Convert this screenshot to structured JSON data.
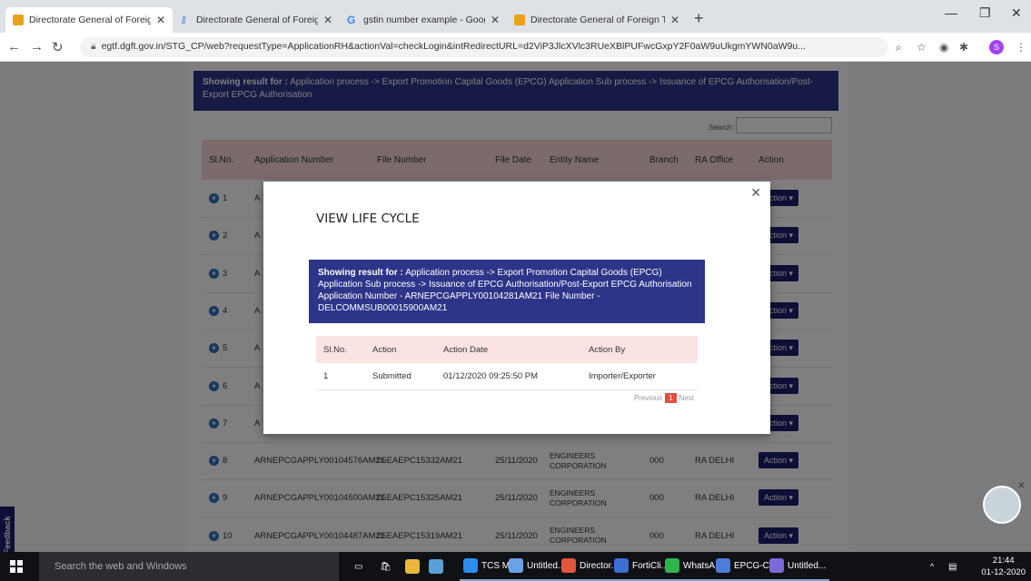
{
  "browser": {
    "tabs": [
      {
        "title": "Directorate General of Foreign T",
        "favicon": "dgft-icon",
        "active": true
      },
      {
        "title": "Directorate General of Foreign T",
        "favicon": "key-icon",
        "active": false
      },
      {
        "title": "gstin number example - Google",
        "favicon": "google-icon",
        "active": false
      },
      {
        "title": "Directorate General of Foreign T",
        "favicon": "dgft-icon",
        "active": false
      }
    ],
    "url": "egtf.dgft.gov.in/STG_CP/web?requestType=ApplicationRH&actionVal=checkLogin&intRedirectURL=d2ViP3JlcXVlc3RUeXBlPUFwcGxpY2F0aW9uUkgmYWN0aW9u...",
    "profile_initial": "S"
  },
  "page": {
    "banner_bold": "Showing result for :",
    "banner_text": " Application process -> Export Promotion Capital Goods (EPCG) Application Sub process -> Issuance of EPCG Authorisation/Post-Export EPCG Authorisation",
    "search_label": "Search:",
    "columns": [
      "Sl.No.",
      "Application Number",
      "File Number",
      "File Date",
      "Entity Name",
      "Branch",
      "RA Office",
      "Action"
    ],
    "action_label": "Action ▾",
    "rows": [
      {
        "sl": "1",
        "app": "A",
        "file": "",
        "date": "",
        "entity": "",
        "branch": "",
        "ra": ""
      },
      {
        "sl": "2",
        "app": "A",
        "file": "",
        "date": "",
        "entity": "",
        "branch": "",
        "ra": ""
      },
      {
        "sl": "3",
        "app": "A",
        "file": "",
        "date": "",
        "entity": "",
        "branch": "",
        "ra": ""
      },
      {
        "sl": "4",
        "app": "A",
        "file": "",
        "date": "",
        "entity": "",
        "branch": "",
        "ra": ""
      },
      {
        "sl": "5",
        "app": "A",
        "file": "",
        "date": "",
        "entity": "",
        "branch": "",
        "ra": ""
      },
      {
        "sl": "6",
        "app": "A",
        "file": "",
        "date": "",
        "entity": "",
        "branch": "",
        "ra": ""
      },
      {
        "sl": "7",
        "app": "A",
        "file": "",
        "date": "",
        "entity": "",
        "branch": "",
        "ra": ""
      },
      {
        "sl": "8",
        "app": "ARNEPCGAPPLY00104576AM21",
        "file": "05EAEPC15332AM21",
        "date": "25/11/2020",
        "entity": "ENGINEERS CORPORATION",
        "branch": "000",
        "ra": "RA DELHI"
      },
      {
        "sl": "9",
        "app": "ARNEPCGAPPLY00104500AM21",
        "file": "05EAEPC15325AM21",
        "date": "25/11/2020",
        "entity": "ENGINEERS CORPORATION",
        "branch": "000",
        "ra": "RA DELHI"
      },
      {
        "sl": "10",
        "app": "ARNEPCGAPPLY00104487AM21",
        "file": "05EAEPC15319AM21",
        "date": "25/11/2020",
        "entity": "ENGINEERS CORPORATION",
        "branch": "000",
        "ra": "RA DELHI"
      }
    ],
    "feedback": "Feedback"
  },
  "modal": {
    "title": "VIEW LIFE CYCLE",
    "banner_bold": "Showing result for :",
    "banner_text": " Application process -> Export Promotion Capital Goods (EPCG) Application Sub process -> Issuance of EPCG Authorisation/Post-Export EPCG Authorisation Application Number - ARNEPCGAPPLY00104281AM21 File Number - DELCOMMSUB00015900AM21",
    "columns": [
      "Sl.No.",
      "Action",
      "Action Date",
      "Action By"
    ],
    "rows": [
      {
        "sl": "1",
        "action": "Submitted",
        "date": "01/12/2020 09:25:50 PM",
        "by": "Importer/Exporter"
      }
    ],
    "pager": {
      "prev": "Previous",
      "current": "1",
      "next": "Next"
    }
  },
  "taskbar": {
    "search_placeholder": "Search the web and Windows",
    "apps": [
      {
        "label": "TCS Ma...",
        "color": "#2d8cf0"
      },
      {
        "label": "Untitled...",
        "color": "#6aa2e6"
      },
      {
        "label": "Director...",
        "color": "#e0553b"
      },
      {
        "label": "FortiCli...",
        "color": "#3b6fd1"
      },
      {
        "label": "WhatsA...",
        "color": "#2fb34b"
      },
      {
        "label": "EPCG-C...",
        "color": "#4a7ed9"
      },
      {
        "label": "Untitled...",
        "color": "#7a6ad9"
      }
    ],
    "time": "21:44",
    "date": "01-12-2020"
  }
}
